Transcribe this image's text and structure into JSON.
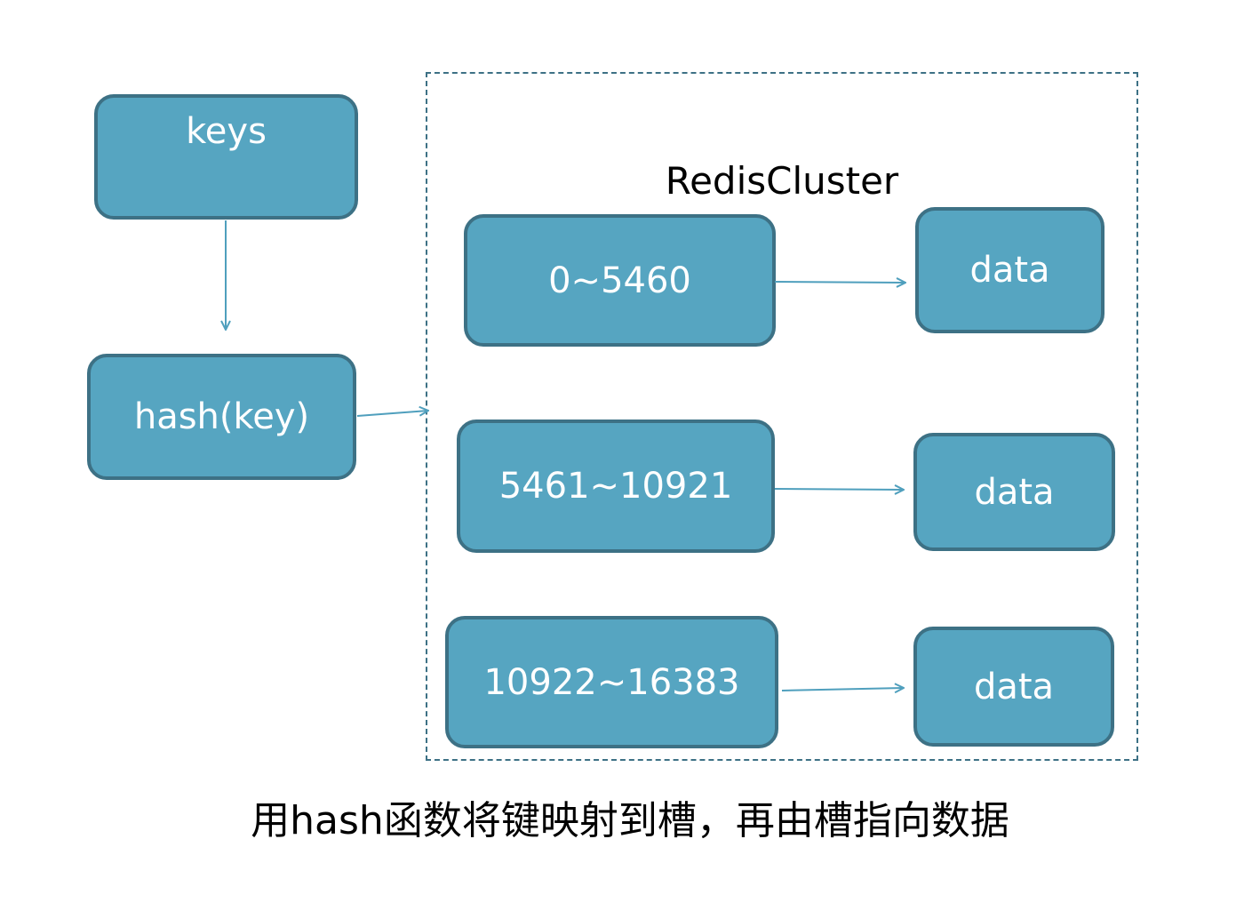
{
  "cluster": {
    "title": "RedisCluster"
  },
  "nodes": {
    "keys": "keys",
    "hash": "hash(key)",
    "slots": [
      "0~5460",
      "5461~10921",
      "10922~16383"
    ],
    "data": [
      "data",
      "data",
      "data"
    ]
  },
  "caption": "用hash函数将键映射到槽，再由槽指向数据",
  "colors": {
    "box_fill": "#56a5c1",
    "box_border": "#3d7185",
    "arrow": "#4f9fbd"
  }
}
